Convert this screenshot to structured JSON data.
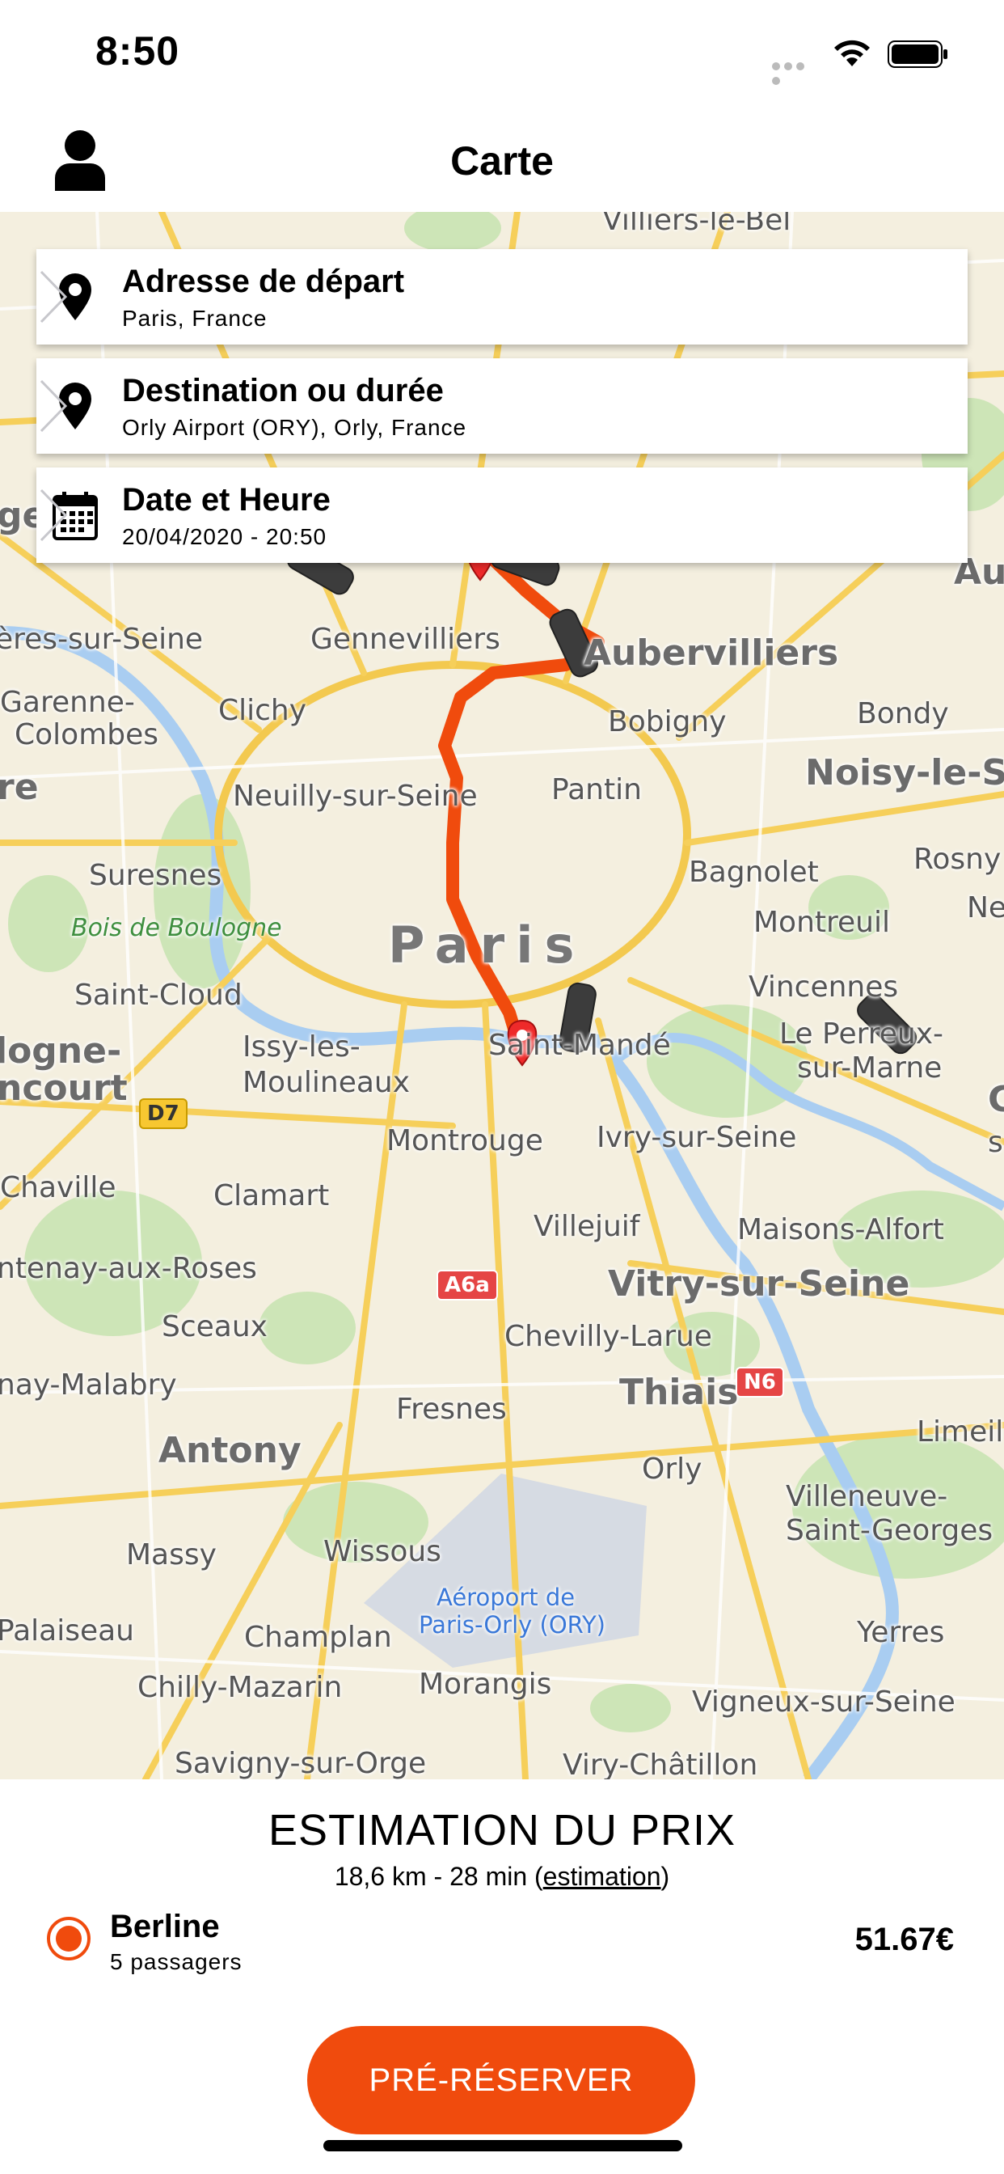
{
  "status_bar": {
    "time": "8:50"
  },
  "header": {
    "title": "Carte",
    "profile_icon": "person-icon"
  },
  "address_cards": [
    {
      "title": "Adresse de départ",
      "subtitle": "Paris, France",
      "icon": "location-pin-icon"
    },
    {
      "title": "Destination ou durée",
      "subtitle": "Orly Airport (ORY), Orly, France",
      "icon": "location-pin-icon"
    },
    {
      "title": "Date et Heure",
      "subtitle": "20/04/2020 - 20:50",
      "icon": "calendar-icon"
    }
  ],
  "map": {
    "labels": [
      "Villiers-le-Bel",
      "Aulnay",
      "ères-sur-Seine",
      "Gennevilliers",
      "Aubervilliers",
      "Garenne-",
      "Colombes",
      "Clichy",
      "Bobigny",
      "Bondy",
      "Noisy-le-S",
      "Neuilly-sur-Seine",
      "Pantin",
      "Suresnes",
      "Bagnolet",
      "Rosny",
      "Bois de Boulogne",
      "Montreuil",
      "Paris",
      "Saint-Cloud",
      "Vincennes",
      "logne-",
      "Issy-les-",
      "Moulineaux",
      "Saint-Mandé",
      "Le Perreux-",
      "sur-Marne",
      "ncourt",
      "Montrouge",
      "Ivry-sur-Seine",
      "Chaville",
      "Clamart",
      "Villejuif",
      "Maisons-Alfort",
      "ntenay-aux-Roses",
      "Vitry-sur-Seine",
      "Sceaux",
      "Chevilly-Larue",
      "nay-Malabry",
      "Thiais",
      "Fresnes",
      "Antony",
      "Orly",
      "Limeil",
      "Villeneuve-",
      "Saint-Georges",
      "Massy",
      "Wissous",
      "Aéroport de",
      "Paris-Orly (ORY)",
      "Palaiseau",
      "Champlan",
      "Yerres",
      "Chilly-Mazarin",
      "Morangis",
      "Vigneux-sur-Seine",
      "Savigny-sur-Orge",
      "Viry-Châtillon",
      "Ne",
      "C",
      "s",
      "ge",
      "re"
    ],
    "road_signs": [
      "D7",
      "A6a",
      "N6"
    ],
    "route_color": "#f04b0d"
  },
  "estimate": {
    "title": "ESTIMATION DU PRIX",
    "distance_time": "18,6 km - 28 min (",
    "link": "estimation",
    "close": ")"
  },
  "vehicle": {
    "name": "Berline",
    "passengers": "5 passagers",
    "price": "51.67€",
    "selected": true
  },
  "cta": {
    "label": "PRÉ-RÉSERVER"
  },
  "colors": {
    "accent": "#f04b0d"
  }
}
